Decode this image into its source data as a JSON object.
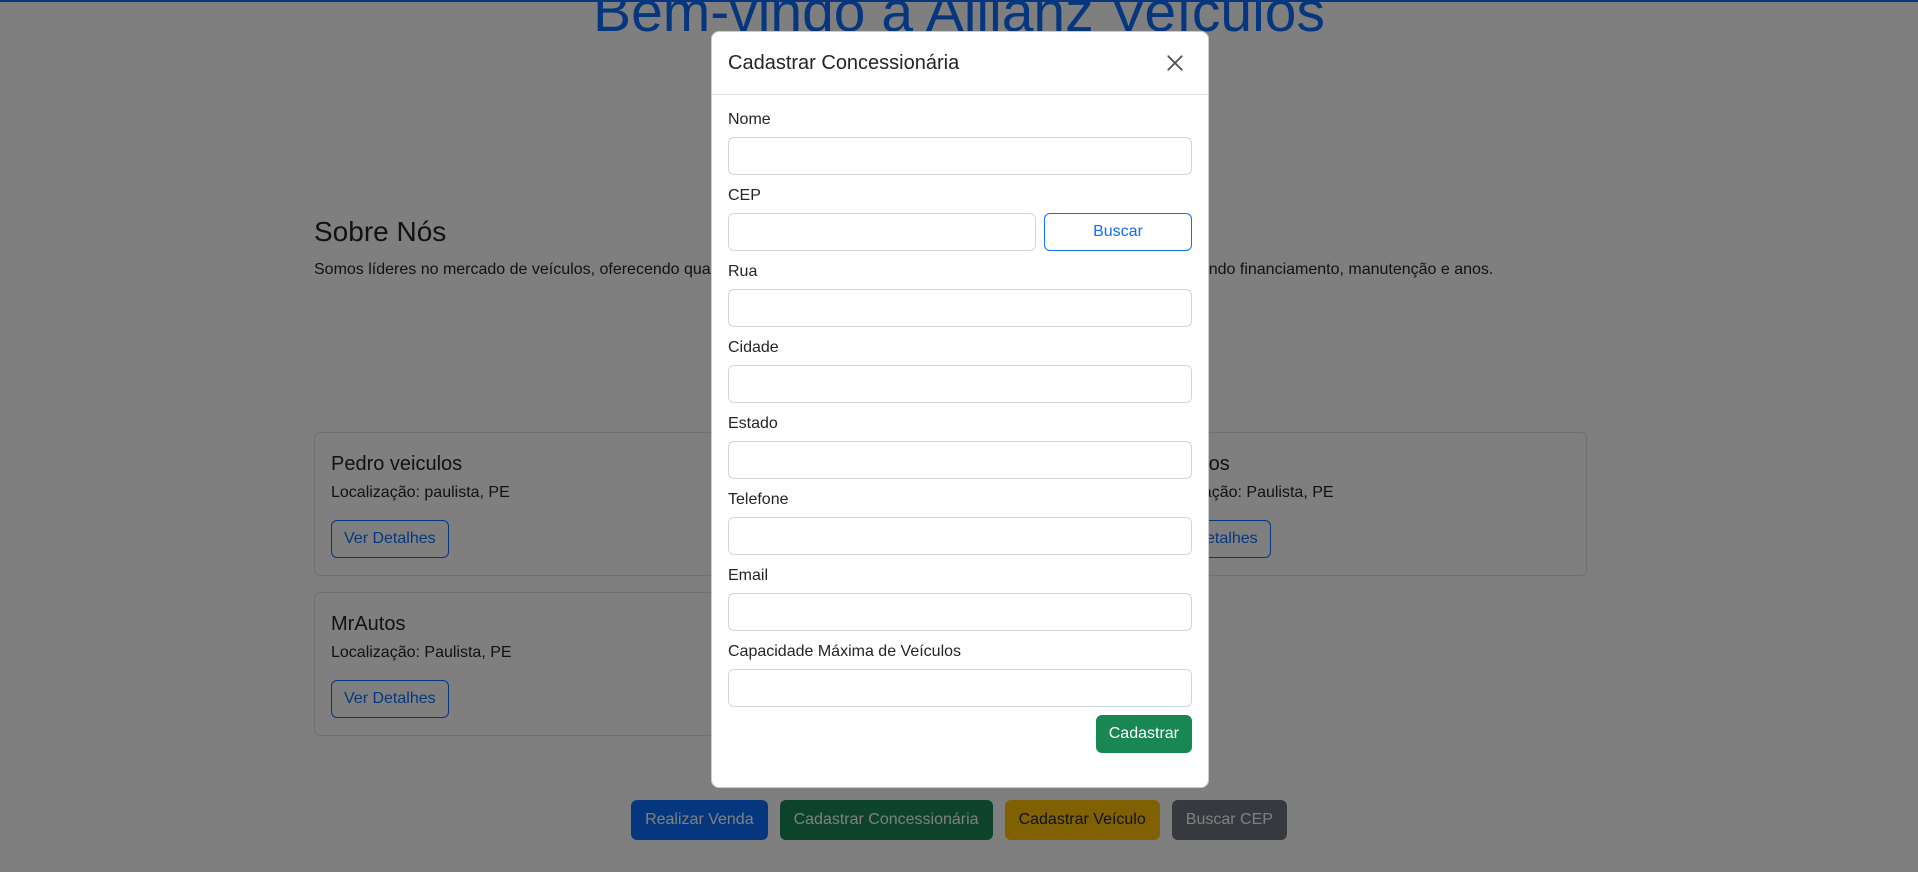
{
  "hero": {
    "title": "Bem-vindo à Allianz Veículos"
  },
  "about": {
    "heading": "Sobre Nós",
    "text": "Somos líderes no mercado de veículos, oferecendo qualidade e confiança. Conheça nossas concessionárias e serviços, incluindo financiamento, manutenção e anos."
  },
  "cards": [
    {
      "name": "Pedro veiculos",
      "location": "Localização: paulista, PE",
      "button": "Ver Detalhes"
    },
    {
      "name": "NuAutos",
      "location": "Localização: Paulista, PE",
      "button": "Ver Detalhes"
    },
    {
      "name": "MrAutos",
      "location": "Localização: Paulista, PE",
      "button": "Ver Detalhes"
    }
  ],
  "actions": {
    "sale": "Realizar Venda",
    "register_dealer": "Cadastrar Concessionária",
    "register_vehicle": "Cadastrar Veículo",
    "search_cep": "Buscar CEP"
  },
  "modal": {
    "title": "Cadastrar Concessionária",
    "fields": {
      "nome": {
        "label": "Nome",
        "value": ""
      },
      "cep": {
        "label": "CEP",
        "value": ""
      },
      "rua": {
        "label": "Rua",
        "value": ""
      },
      "cidade": {
        "label": "Cidade",
        "value": ""
      },
      "estado": {
        "label": "Estado",
        "value": ""
      },
      "telefone": {
        "label": "Telefone",
        "value": ""
      },
      "email": {
        "label": "Email",
        "value": ""
      },
      "capacidade": {
        "label": "Capacidade Máxima de Veículos",
        "value": ""
      }
    },
    "search_button": "Buscar",
    "submit_button": "Cadastrar"
  },
  "colors": {
    "primary": "#0d6efd",
    "success": "#198754",
    "warning": "#ffc107",
    "secondary": "#6c757d",
    "backdrop": "rgba(0,0,0,0.5)"
  }
}
